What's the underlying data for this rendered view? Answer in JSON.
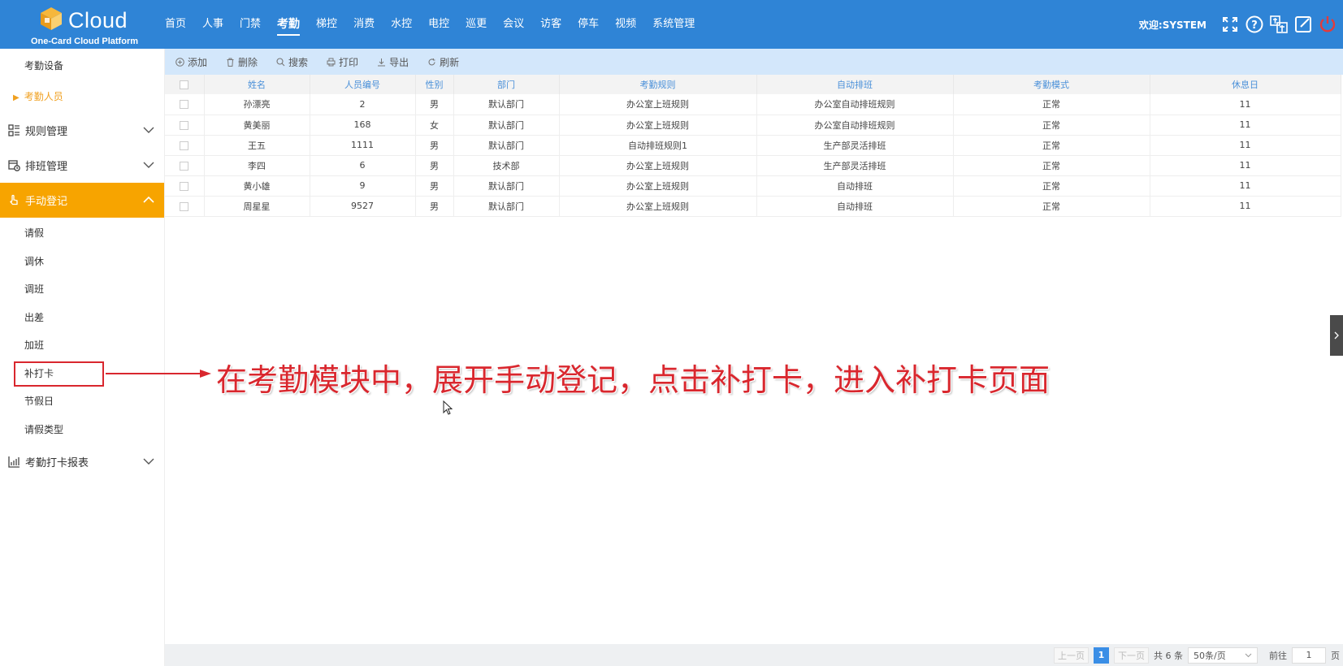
{
  "app": {
    "logo_text": "Cloud",
    "logo_subtitle": "One-Card Cloud Platform",
    "welcome": "欢迎:SYSTEM"
  },
  "nav": {
    "items": [
      "首页",
      "人事",
      "门禁",
      "考勤",
      "梯控",
      "消费",
      "水控",
      "电控",
      "巡更",
      "会议",
      "访客",
      "停车",
      "视频",
      "系统管理"
    ],
    "active": "考勤"
  },
  "header_icons": [
    "fullscreen-icon",
    "help-icon",
    "language-icon",
    "edit-icon",
    "power-icon"
  ],
  "sidebar": {
    "top_items": [
      "考勤设备",
      "考勤人员"
    ],
    "current": "考勤人员",
    "groups": {
      "rules": "规则管理",
      "shift": "排班管理",
      "manual": "手动登记",
      "report": "考勤打卡报表"
    },
    "manual_children": [
      "请假",
      "调休",
      "调班",
      "出差",
      "加班",
      "补打卡",
      "节假日",
      "请假类型"
    ]
  },
  "toolbar": {
    "add": "添加",
    "delete": "删除",
    "search": "搜索",
    "print": "打印",
    "export": "导出",
    "refresh": "刷新"
  },
  "table": {
    "columns": [
      "姓名",
      "人员编号",
      "性别",
      "部门",
      "考勤规则",
      "自动排班",
      "考勤模式",
      "休息日"
    ],
    "rows": [
      {
        "name": "孙漂亮",
        "id": "2",
        "gender": "男",
        "dept": "默认部门",
        "rule": "办公室上班规则",
        "auto": "办公室自动排班规则",
        "mode": "正常",
        "rest": "11"
      },
      {
        "name": "黄美丽",
        "id": "168",
        "gender": "女",
        "dept": "默认部门",
        "rule": "办公室上班规则",
        "auto": "办公室自动排班规则",
        "mode": "正常",
        "rest": "11"
      },
      {
        "name": "王五",
        "id": "1111",
        "gender": "男",
        "dept": "默认部门",
        "rule": "自动排班规则1",
        "auto": "生产部灵活排班",
        "mode": "正常",
        "rest": "11"
      },
      {
        "name": "李四",
        "id": "6",
        "gender": "男",
        "dept": "技术部",
        "rule": "办公室上班规则",
        "auto": "生产部灵活排班",
        "mode": "正常",
        "rest": "11"
      },
      {
        "name": "黄小雄",
        "id": "9",
        "gender": "男",
        "dept": "默认部门",
        "rule": "办公室上班规则",
        "auto": "自动排班",
        "mode": "正常",
        "rest": "11"
      },
      {
        "name": "周星星",
        "id": "9527",
        "gender": "男",
        "dept": "默认部门",
        "rule": "办公室上班规则",
        "auto": "自动排班",
        "mode": "正常",
        "rest": "11"
      }
    ]
  },
  "pagination": {
    "prev": "上一页",
    "current_page": "1",
    "next": "下一页",
    "total": "共 6 条",
    "page_size": "50条/页",
    "goto_label": "前往",
    "goto_value": "1",
    "page_unit": "页"
  },
  "annotation": {
    "text": "在考勤模块中，展开手动登记，点击补打卡，进入补打卡页面"
  },
  "colors": {
    "header": "#2f84d6",
    "active_group": "#f7a400",
    "annotation": "#d9272e",
    "toolbar": "#d3e7fb"
  }
}
